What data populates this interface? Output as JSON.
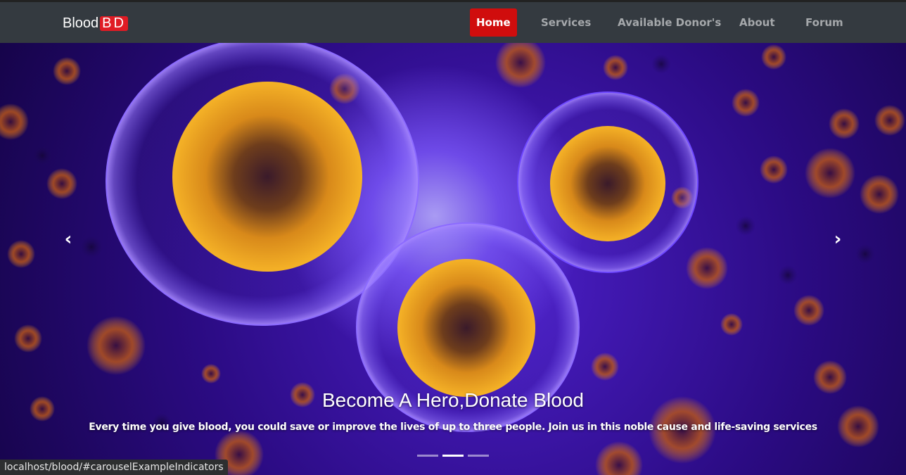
{
  "brand": {
    "name": "Blood",
    "badge": "BD"
  },
  "nav": {
    "items": [
      {
        "label": "Home",
        "active": true
      },
      {
        "label": "Services",
        "active": false
      },
      {
        "label": "Available Donor's",
        "active": false
      },
      {
        "label": "About",
        "active": false
      },
      {
        "label": "Forum",
        "active": false
      }
    ]
  },
  "carousel": {
    "title": "Become A Hero,Donate Blood",
    "text": "Every time you give blood, you could save or improve the lives of up to three people. Join us in this noble cause and life-saving services",
    "prev_icon": "chevron-left-icon",
    "next_icon": "chevron-right-icon",
    "prev_glyph": "‹",
    "next_glyph": "›",
    "slide_count": 3,
    "active_slide": 2
  },
  "status_bar": {
    "url": "localhost/blood/#carouselExampleIndicators"
  },
  "colors": {
    "accent": "#d00d0d",
    "navbar": "#343a40",
    "cell_core": "#f2a51a",
    "membrane": "#7b5cff"
  }
}
